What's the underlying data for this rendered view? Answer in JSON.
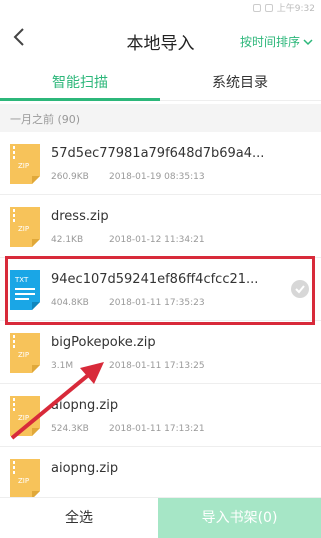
{
  "status": {
    "time": "上午9:32"
  },
  "header": {
    "title": "本地导入",
    "sort_label": "按时间排序"
  },
  "tabs": [
    {
      "label": "智能扫描",
      "active": true
    },
    {
      "label": "系统目录",
      "active": false
    }
  ],
  "section": {
    "label": "一月之前 (90)"
  },
  "files": [
    {
      "name": "57d5ec77981a79f648d7b69a4...",
      "size": "260.9KB",
      "date": "2018-01-19 08:35:13",
      "type": "ZIP"
    },
    {
      "name": "dress.zip",
      "size": "42.1KB",
      "date": "2018-01-12 11:34:21",
      "type": "ZIP"
    },
    {
      "name": "94ec107d59241ef86ff4cfcc21...",
      "size": "404.8KB",
      "date": "2018-01-11 17:35:23",
      "type": "TXT"
    },
    {
      "name": "bigPokepoke.zip",
      "size": "3.1M",
      "date": "2018-01-11 17:13:25",
      "type": "ZIP"
    },
    {
      "name": "aiopng.zip",
      "size": "524.3KB",
      "date": "2018-01-11 17:13:21",
      "type": "ZIP"
    },
    {
      "name": "aiopng.zip",
      "size": "",
      "date": "",
      "type": "ZIP"
    }
  ],
  "footer": {
    "select_all": "全选",
    "import": "导入书架(0)"
  },
  "colors": {
    "accent": "#2cb77a",
    "highlight": "#d82a3a",
    "zip": "#f7c35a",
    "txt": "#1aa6e6"
  }
}
